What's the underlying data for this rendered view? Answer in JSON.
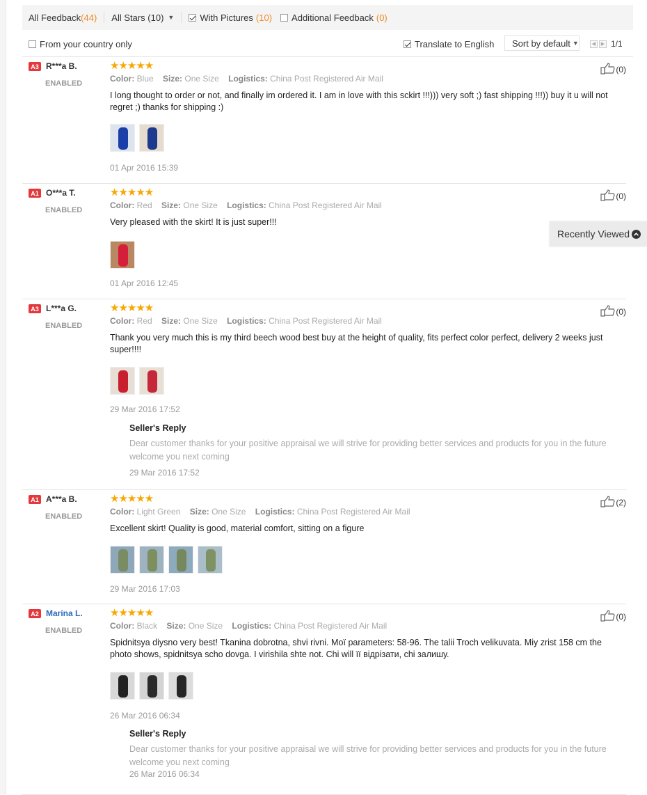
{
  "filters": {
    "all_feedback_label": "All Feedback",
    "all_feedback_count": "(44)",
    "all_stars_label": "All Stars (10)",
    "with_pictures_label": "With Pictures",
    "with_pictures_count": "(10)",
    "with_pictures_checked": true,
    "additional_label": "Additional Feedback",
    "additional_count": "(0)",
    "additional_checked": false
  },
  "options": {
    "country_label": "From your country only",
    "country_checked": false,
    "translate_label": "Translate to English",
    "translate_checked": true,
    "sort_label": "Sort by default",
    "page_indicator": "1/1"
  },
  "recently_viewed": "Recently Viewed",
  "colors": {
    "accent": "#f08a24",
    "star": "#f7a700",
    "badge": "#e4393c",
    "link": "#2a6bc0"
  },
  "labels": {
    "color": "Color:",
    "size": "Size:",
    "logistics": "Logistics:",
    "seller_reply": "Seller's Reply"
  },
  "reviews": [
    {
      "level": "A3",
      "name": "R***a B.",
      "status": "ENABLED",
      "stars": "★★★★★",
      "color": "Blue",
      "size": "One Size",
      "logistics": "China Post Registered Air Mail",
      "text": "I long thought to order or not, and finally im ordered it. I am in love with this sckirt !!!))) very soft ;) fast shipping !!!)) buy it u will not regret ;) thanks for shipping :)",
      "date": "01 Apr 2016 15:39",
      "likes": "(0)",
      "photo_count": 2
    },
    {
      "level": "A1",
      "name": "O***a T.",
      "status": "ENABLED",
      "stars": "★★★★★",
      "color": "Red",
      "size": "One Size",
      "logistics": "China Post Registered Air Mail",
      "text": "Very pleased with the skirt! It is just super!!!",
      "date": "01 Apr 2016 12:45",
      "likes": "(0)",
      "photo_count": 1
    },
    {
      "level": "A3",
      "name": "L***a G.",
      "status": "ENABLED",
      "stars": "★★★★★",
      "color": "Red",
      "size": "One Size",
      "logistics": "China Post Registered Air Mail",
      "text": "Thank you very much this is my third beech wood best buy at the height of quality, fits perfect color perfect, delivery 2 weeks just super!!!!",
      "date": "29 Mar 2016 17:52",
      "likes": "(0)",
      "photo_count": 2,
      "reply": {
        "text": "Dear customer thanks for your positive appraisal we will strive for providing better services and products for you in the future welcome you next coming",
        "date": "29 Mar 2016 17:52"
      }
    },
    {
      "level": "A1",
      "name": "A***a B.",
      "status": "ENABLED",
      "stars": "★★★★★",
      "color": "Light Green",
      "size": "One Size",
      "logistics": "China Post Registered Air Mail",
      "text": "Excellent skirt! Quality is good, material comfort, sitting on a figure",
      "date": "29 Mar 2016 17:03",
      "likes": "(2)",
      "photo_count": 4
    },
    {
      "level": "A2",
      "name": "Marina L.",
      "status": "ENABLED",
      "stars": "★★★★★",
      "color": "Black",
      "size": "One Size",
      "logistics": "China Post Registered Air Mail",
      "text": "Spidnitsya diysno very best! Tkanina dobrotna, shvi rivni. Моï parameters: 58-96. The talii Troch velikuvata. Miy zrist 158 cm the photo shows, spidnitsya scho dovga. I virishila shte not. Chi will її відрізати, chi залишу.",
      "date": "26 Mar 2016 06:34",
      "likes": "(0)",
      "photo_count": 3,
      "reply": {
        "text": "Dear customer thanks for your positive appraisal we will strive for providing better services and products for you in the future welcome you next coming",
        "date": "26 Mar 2016 06:34"
      }
    }
  ]
}
